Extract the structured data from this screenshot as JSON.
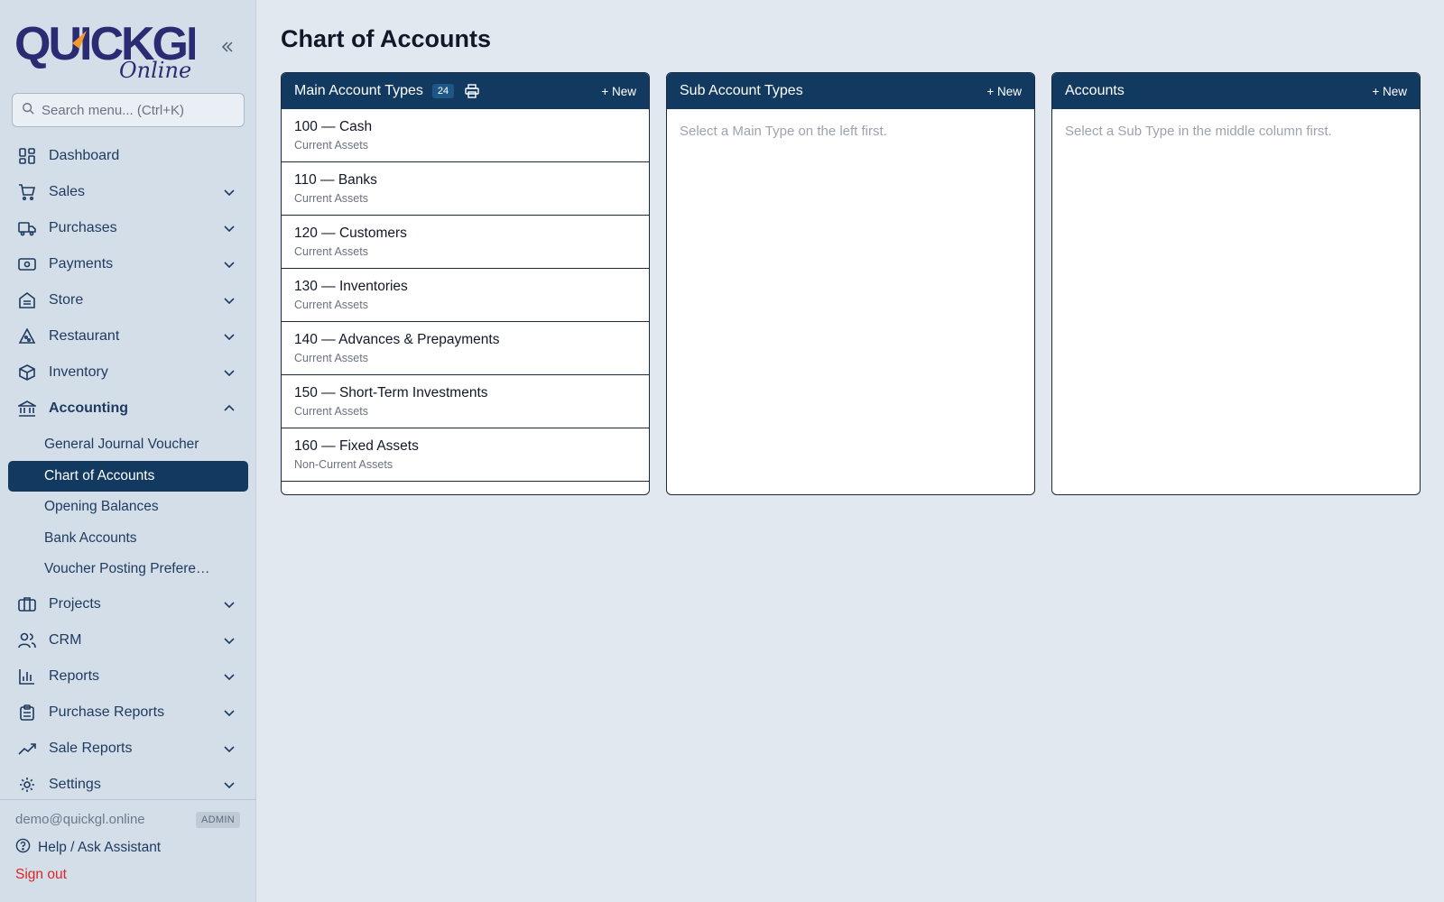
{
  "brand": {
    "logo_main": "QUICKGL",
    "logo_sub": "Online"
  },
  "search": {
    "placeholder": "Search menu... (Ctrl+K)"
  },
  "nav": {
    "dashboard": "Dashboard",
    "sales": "Sales",
    "purchases": "Purchases",
    "payments": "Payments",
    "store": "Store",
    "restaurant": "Restaurant",
    "inventory": "Inventory",
    "accounting": "Accounting",
    "accounting_items": [
      "General Journal Voucher",
      "Chart of Accounts",
      "Opening Balances",
      "Bank Accounts",
      "Voucher Posting Prefere…"
    ],
    "projects": "Projects",
    "crm": "CRM",
    "reports": "Reports",
    "purchase_reports": "Purchase Reports",
    "sale_reports": "Sale Reports",
    "settings": "Settings"
  },
  "footer": {
    "email": "demo@quickgl.online",
    "role": "ADMIN",
    "help": "Help / Ask Assistant",
    "signout": "Sign out"
  },
  "page": {
    "title": "Chart of Accounts"
  },
  "main_types": {
    "title": "Main Account Types",
    "count": "24",
    "new_label": "+ New",
    "rows": [
      {
        "code": "100 — Cash",
        "category": "Current Assets"
      },
      {
        "code": "110 — Banks",
        "category": "Current Assets"
      },
      {
        "code": "120 — Customers",
        "category": "Current Assets"
      },
      {
        "code": "130 — Inventories",
        "category": "Current Assets"
      },
      {
        "code": "140 — Advances & Prepayments",
        "category": "Current Assets"
      },
      {
        "code": "150 — Short-Term Investments",
        "category": "Current Assets"
      },
      {
        "code": "160 — Fixed Assets",
        "category": "Non-Current Assets"
      }
    ]
  },
  "sub_types": {
    "title": "Sub Account Types",
    "new_label": "+ New",
    "empty": "Select a Main Type on the left first."
  },
  "accounts": {
    "title": "Accounts",
    "new_label": "+ New",
    "empty": "Select a Sub Type in the middle column first."
  },
  "colors": {
    "primary": "#123a60",
    "sidebar": "#d3dee9",
    "background": "#e2e8f0",
    "danger": "#dc2626",
    "logo_navy": "#2b2a72",
    "logo_orange": "#f29a2e"
  }
}
